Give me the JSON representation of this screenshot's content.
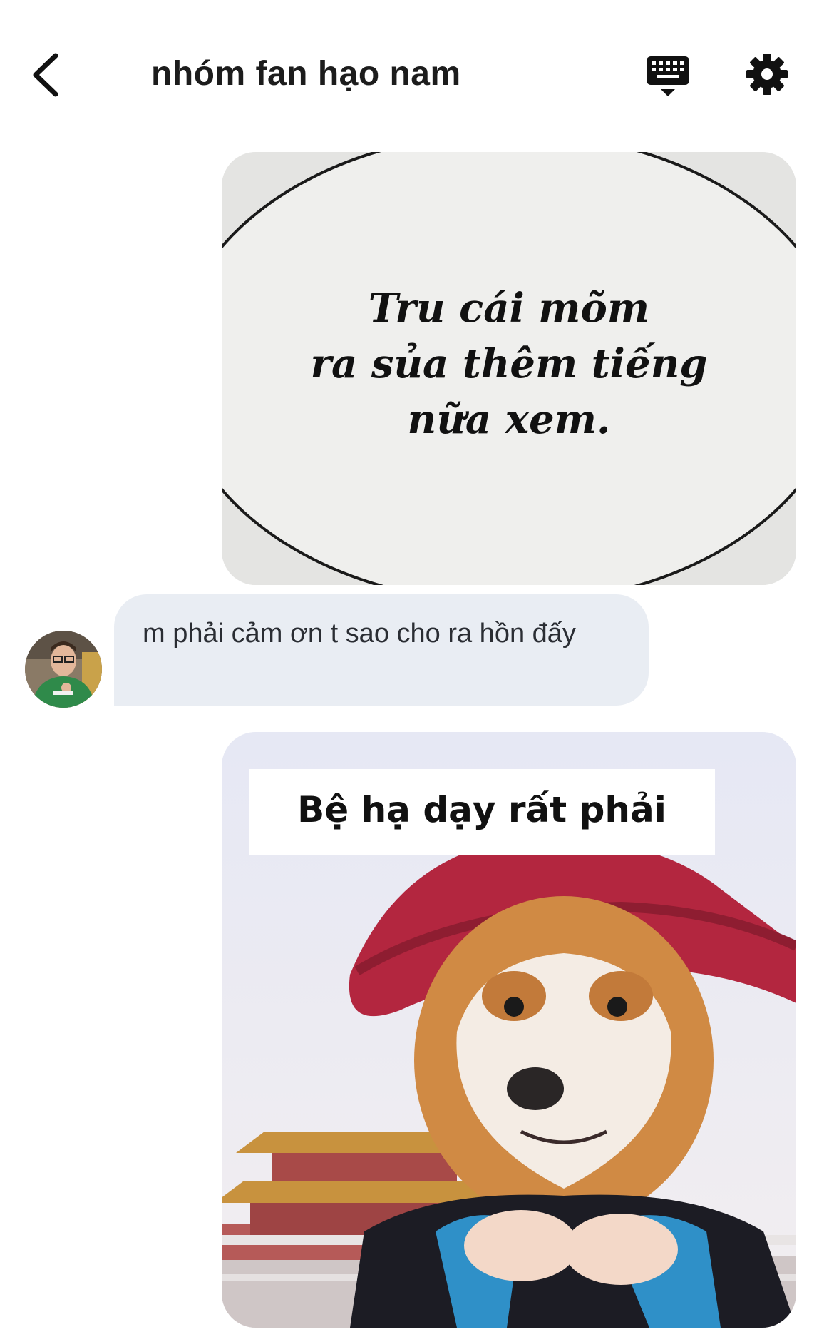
{
  "header": {
    "title": "nhóm fan hạo nam",
    "back_icon": "chevron-left-icon",
    "keyboard_icon": "keyboard-hide-icon",
    "settings_icon": "gear-icon"
  },
  "messages": [
    {
      "type": "image",
      "direction": "outgoing",
      "caption": [
        "Tru cái mõm",
        "ra sủa thêm tiếng",
        "nữa xem."
      ]
    },
    {
      "type": "text",
      "direction": "incoming",
      "text": "m phải cảm ơn t sao cho ra hồn đấy"
    },
    {
      "type": "image",
      "direction": "outgoing",
      "caption": "Bệ hạ dạy rất phải"
    }
  ],
  "colors": {
    "bubble_incoming": "#e9edf3",
    "title_text": "#1c1c1c",
    "hat_red": "#b3263f"
  }
}
